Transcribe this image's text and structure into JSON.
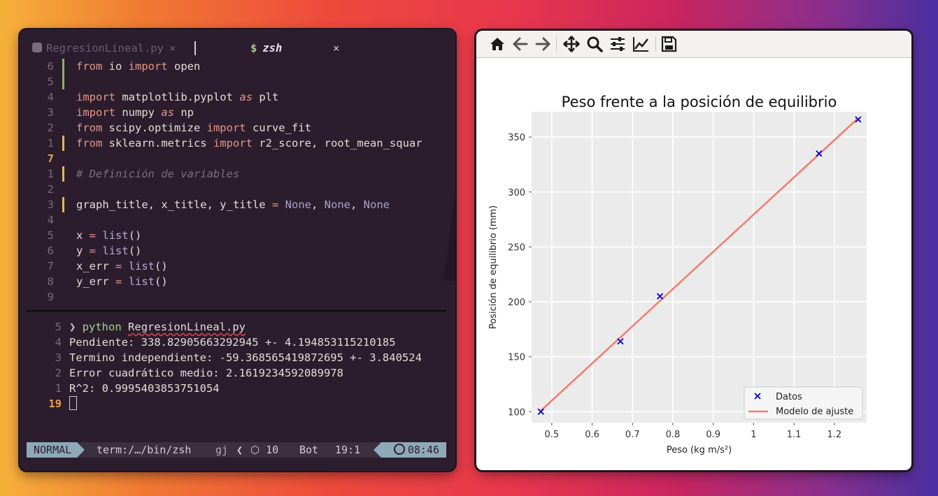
{
  "editor": {
    "tabs": [
      {
        "label": "RegresionLineal.py",
        "close": "×"
      },
      {
        "label": "zsh",
        "prefix": "$",
        "close": "×"
      }
    ],
    "code_lines": [
      {
        "num": "6",
        "gutter": "add",
        "html": "<span class='kw'>from</span> io <span class='kw'>import</span> open"
      },
      {
        "num": "5",
        "gutter": "add",
        "html": ""
      },
      {
        "num": "4",
        "gutter": "",
        "html": "<span class='kw'>import</span> matplotlib.pyplot <span class='as'>as</span> plt"
      },
      {
        "num": "3",
        "gutter": "",
        "html": "<span class='kw'>import</span> numpy <span class='as'>as</span> np"
      },
      {
        "num": "2",
        "gutter": "",
        "html": "<span class='kw'>from</span> scipy.optimize <span class='kw'>import</span> curve_fit"
      },
      {
        "num": "1",
        "gutter": "chg",
        "html": "<span class='kw'>from</span> sklearn.metrics <span class='kw'>import</span> r2_score, root_mean_squar"
      },
      {
        "num": "7",
        "gutter": "",
        "current": true,
        "html": ""
      },
      {
        "num": "1",
        "gutter": "chg",
        "html": "<span class='cm'># Definición de variables</span>"
      },
      {
        "num": "2",
        "gutter": "",
        "html": ""
      },
      {
        "num": "3",
        "gutter": "chg",
        "html": "graph_title, x_title, y_title <span class='kw'>=</span> <span class='nn'>None</span>, <span class='nn'>None</span>, <span class='nn'>None</span>"
      },
      {
        "num": "4",
        "gutter": "",
        "html": ""
      },
      {
        "num": "5",
        "gutter": "",
        "html": "x <span class='kw'>=</span> <span class='bi'>list</span>()"
      },
      {
        "num": "6",
        "gutter": "",
        "html": "y <span class='kw'>=</span> <span class='bi'>list</span>()"
      },
      {
        "num": "7",
        "gutter": "",
        "html": "x_err <span class='kw'>=</span> <span class='bi'>list</span>()"
      },
      {
        "num": "8",
        "gutter": "",
        "html": "y_err <span class='kw'>=</span> <span class='bi'>list</span>()"
      },
      {
        "num": "9",
        "gutter": "",
        "html": ""
      }
    ],
    "terminal_lines": [
      {
        "num": "5",
        "html": "<span class='prompt-arrow'>❯</span> <span class='py-cmd'>python</span> <span class='py-file'>RegresionLineal.py</span>"
      },
      {
        "num": "4",
        "html": "Pendiente: 338.82905663292945 +- 4.194853115210185"
      },
      {
        "num": "3",
        "html": "Termino independiente: -59.368565419872695 +- 3.840524"
      },
      {
        "num": "2",
        "html": "Error cuadrático medio: 2.1619234592089978"
      },
      {
        "num": "1",
        "html": "R^2: 0.9995403853751054"
      },
      {
        "num": "19",
        "current": true,
        "html": "<span class='cursor'></span>"
      }
    ],
    "status": {
      "mode": "NORMAL",
      "path": "term:/…/bin/zsh",
      "gj": "gj",
      "chevron": "❮",
      "pkg": "10",
      "position_word": "Bot",
      "cursor_pos": "19:1",
      "time": "08:46"
    }
  },
  "toolbar": {
    "icons": [
      "home-icon",
      "back-icon",
      "forward-icon",
      "pan-icon",
      "zoom-icon",
      "configure-subplots-icon",
      "edit-axis-icon",
      "save-icon"
    ]
  },
  "chart_data": {
    "type": "scatter",
    "title": "Peso frente a la posición de equilibrio",
    "xlabel": "Peso (kg m/s²)",
    "ylabel": "Posición de equilibrio (mm)",
    "xlim": [
      0.45,
      1.28
    ],
    "ylim": [
      90,
      373
    ],
    "xticks": [
      0.5,
      0.6,
      0.7,
      0.8,
      0.9,
      1.0,
      1.1,
      1.2
    ],
    "yticks": [
      100,
      150,
      200,
      250,
      300,
      350
    ],
    "grid": true,
    "legend_position": "bottom-right",
    "series": [
      {
        "name": "Datos",
        "kind": "scatter",
        "marker": "x",
        "color": "#0000cc",
        "x": [
          0.473,
          0.67,
          0.768,
          1.162,
          1.259
        ],
        "y": [
          100,
          164,
          205,
          335,
          366
        ]
      },
      {
        "name": "Modelo de ajuste",
        "kind": "line",
        "color": "#f08070",
        "x": [
          0.473,
          1.259
        ],
        "y": [
          100.9,
          367.2
        ]
      }
    ]
  }
}
